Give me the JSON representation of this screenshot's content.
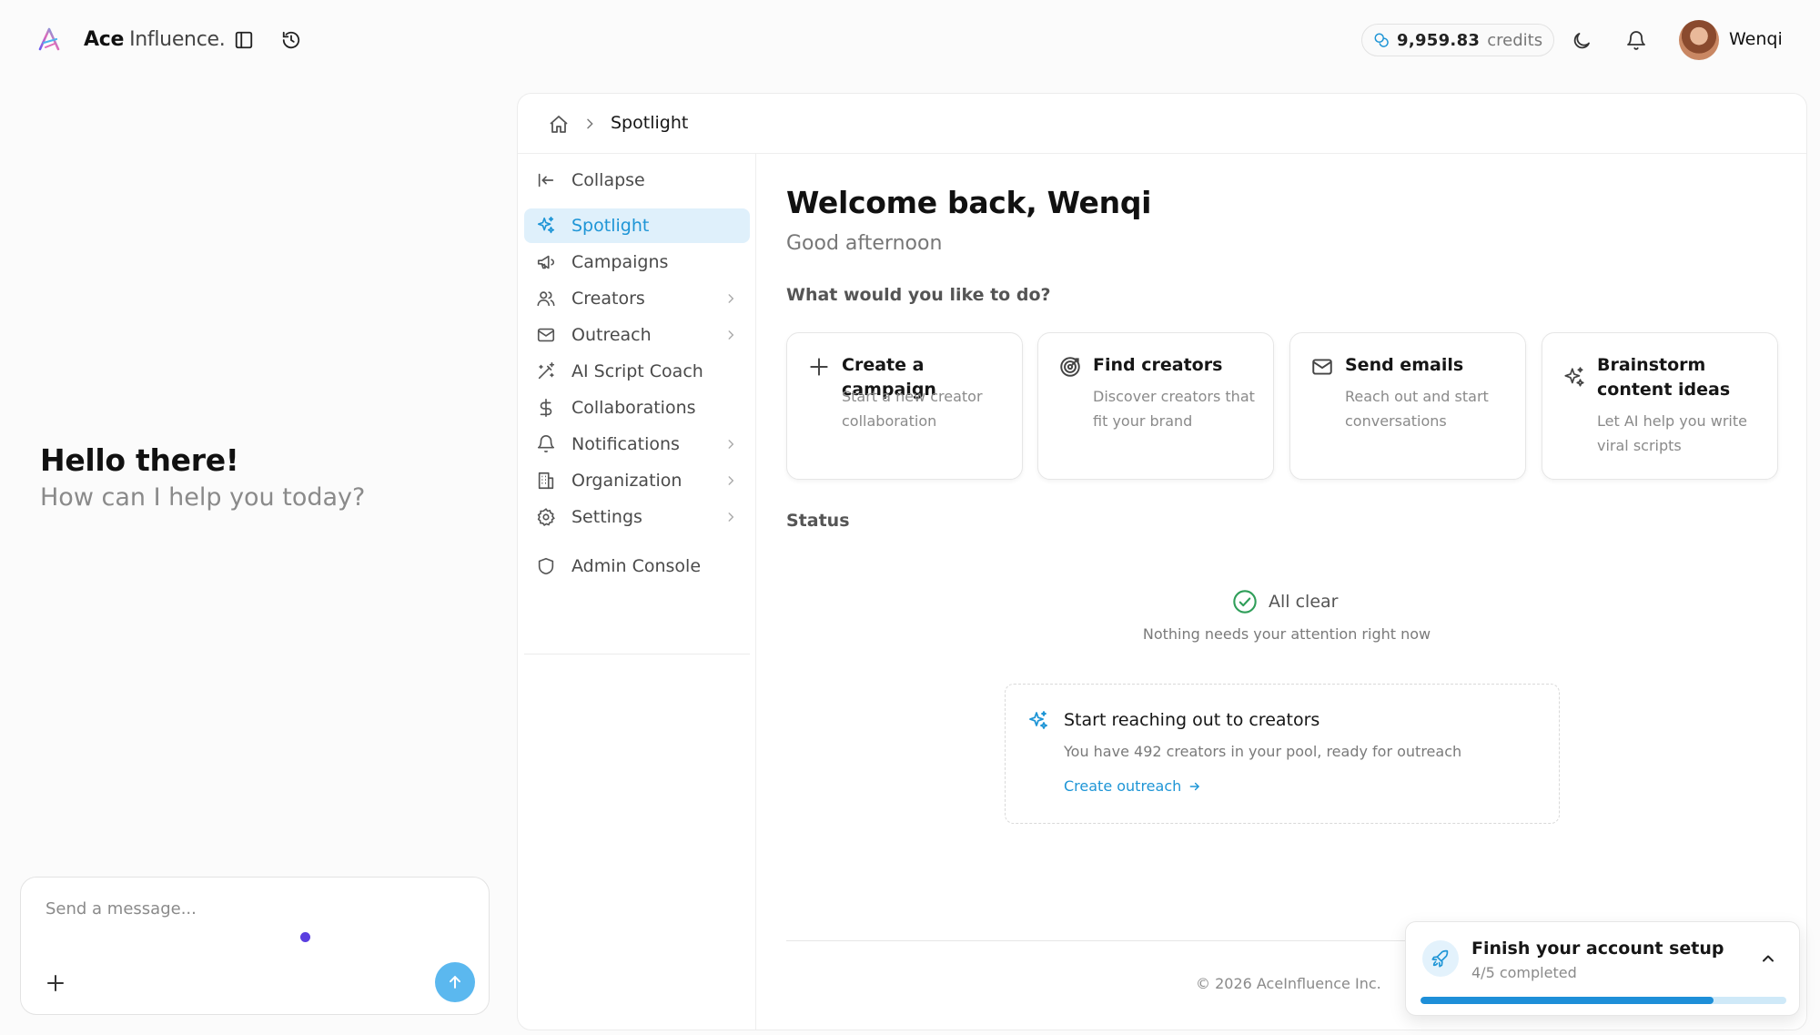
{
  "brand": {
    "name_bold": "Ace",
    "name_light": "Influence."
  },
  "topbar": {
    "credits_amount": "9,959.83",
    "credits_unit": "credits",
    "username": "Wenqi"
  },
  "chat": {
    "greeting_title": "Hello there!",
    "greeting_subtitle": "How can I help you today?",
    "input_placeholder": "Send a message..."
  },
  "breadcrumb": {
    "current": "Spotlight"
  },
  "nav": {
    "items": [
      {
        "label": "Collapse",
        "icon": "arrow-left-to-line-icon"
      },
      {
        "label": "Spotlight",
        "icon": "sparkles-icon",
        "active": true
      },
      {
        "label": "Campaigns",
        "icon": "megaphone-icon"
      },
      {
        "label": "Creators",
        "icon": "users-icon",
        "has_submenu": true
      },
      {
        "label": "Outreach",
        "icon": "mail-icon",
        "has_submenu": true
      },
      {
        "label": "AI Script Coach",
        "icon": "magic-wand-icon"
      },
      {
        "label": "Collaborations",
        "icon": "dollar-icon"
      },
      {
        "label": "Notifications",
        "icon": "bell-icon",
        "has_submenu": true
      },
      {
        "label": "Organization",
        "icon": "building-icon",
        "has_submenu": true
      },
      {
        "label": "Settings",
        "icon": "gear-icon",
        "has_submenu": true
      },
      {
        "label": "Admin Console",
        "icon": "shield-icon"
      }
    ]
  },
  "main": {
    "welcome": "Welcome back, Wenqi",
    "greeting": "Good afternoon",
    "question": "What would you like to do?",
    "actions": [
      {
        "title": "Create a campaign",
        "desc": "Start a new creator collaboration",
        "icon": "plus-icon"
      },
      {
        "title": "Find creators",
        "desc": "Discover creators that fit your brand",
        "icon": "target-icon"
      },
      {
        "title": "Send emails",
        "desc": "Reach out and start conversations",
        "icon": "mail-icon"
      },
      {
        "title": "Brainstorm content ideas",
        "desc": "Let AI help you write viral scripts",
        "icon": "sparkles-icon"
      }
    ],
    "status_label": "Status",
    "status_title": "All clear",
    "status_sub": "Nothing needs your attention right now",
    "outreach": {
      "title": "Start reaching out to creators",
      "desc": "You have 492 creators in your pool, ready for outreach",
      "link": "Create outreach"
    },
    "copyright": "© 2026 AceInfluence Inc."
  },
  "setup": {
    "title": "Finish your account setup",
    "progress_text": "4/5 completed",
    "progress_fraction": 0.8
  },
  "colors": {
    "accent": "#1e95d6",
    "active_bg": "#dff0fb",
    "send_button": "#5bb8ef"
  }
}
